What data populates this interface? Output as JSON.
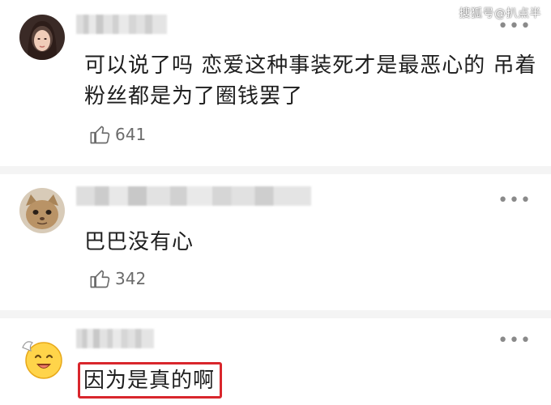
{
  "watermark": "搜狐号@扒点半",
  "comments": [
    {
      "text": "可以说了吗 恋爱这种事装死才是最恶心的 吊着粉丝都是为了圈钱罢了",
      "likes": "641",
      "more_icon": "more-dots-icon"
    },
    {
      "text": "巴巴没有心",
      "likes": "342",
      "more_icon": "more-dots-icon"
    },
    {
      "text": "因为是真的啊",
      "more_icon": "more-dots-icon",
      "highlight_color": "#d9262c"
    }
  ]
}
